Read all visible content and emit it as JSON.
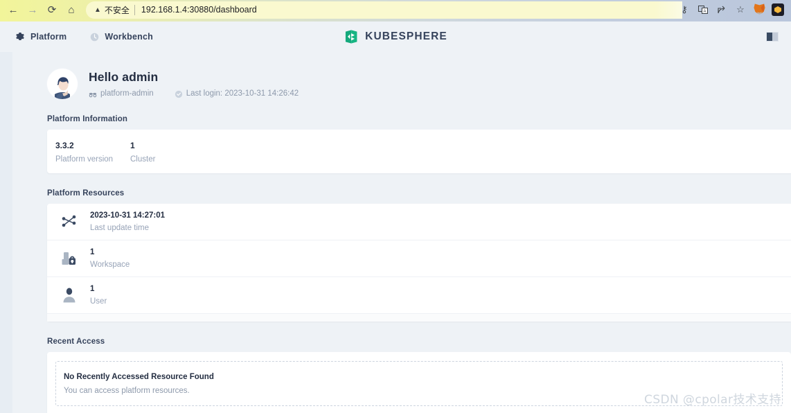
{
  "browser": {
    "back_icon": "back-arrow-icon",
    "forward_icon": "forward-arrow-icon",
    "reload_icon": "reload-icon",
    "home_icon": "home-icon",
    "security_warning": "不安全",
    "warning_icon": "warning-triangle-icon",
    "url": "192.168.1.4:30880/dashboard",
    "toolbar_icons": [
      "key-icon",
      "translate-icon",
      "share-icon",
      "bookmark-star-icon",
      "metamask-extension-icon",
      "wallet-extension-icon"
    ]
  },
  "header": {
    "nav": [
      {
        "label": "Platform",
        "icon": "gear-icon"
      },
      {
        "label": "Workbench",
        "icon": "clock-icon"
      }
    ],
    "brand": "KUBESPHERE",
    "brand_icon": "kubesphere-logo-icon",
    "brand_color": "#1ba675",
    "panel_toggle_icon": "layout-panel-icon"
  },
  "user": {
    "avatar_icon": "user-avatar-icon",
    "greeting": "Hello admin",
    "role_icon": "role-icon",
    "role": "platform-admin",
    "login_icon": "clock-check-icon",
    "last_login": "Last login: 2023-10-31 14:26:42"
  },
  "platform_information": {
    "title": "Platform Information",
    "items": [
      {
        "value": "3.3.2",
        "label": "Platform version"
      },
      {
        "value": "1",
        "label": "Cluster"
      }
    ]
  },
  "platform_resources": {
    "title": "Platform Resources",
    "items": [
      {
        "icon": "network-share-icon",
        "value": "2023-10-31 14:27:01",
        "label": "Last update time"
      },
      {
        "icon": "workspace-lock-icon",
        "value": "1",
        "label": "Workspace"
      },
      {
        "icon": "user-icon",
        "value": "1",
        "label": "User"
      }
    ]
  },
  "recent_access": {
    "title": "Recent Access",
    "empty_title": "No Recently Accessed Resource Found",
    "empty_desc": "You can access platform resources."
  },
  "watermark": "CSDN @cpolar技术支持",
  "colors": {
    "page_bg": "#eef2f6",
    "card_bg": "#ffffff",
    "text_dark": "#242e42",
    "text_muted": "#97a3b7",
    "brand_green": "#1ba675",
    "header_text": "#36435c"
  }
}
